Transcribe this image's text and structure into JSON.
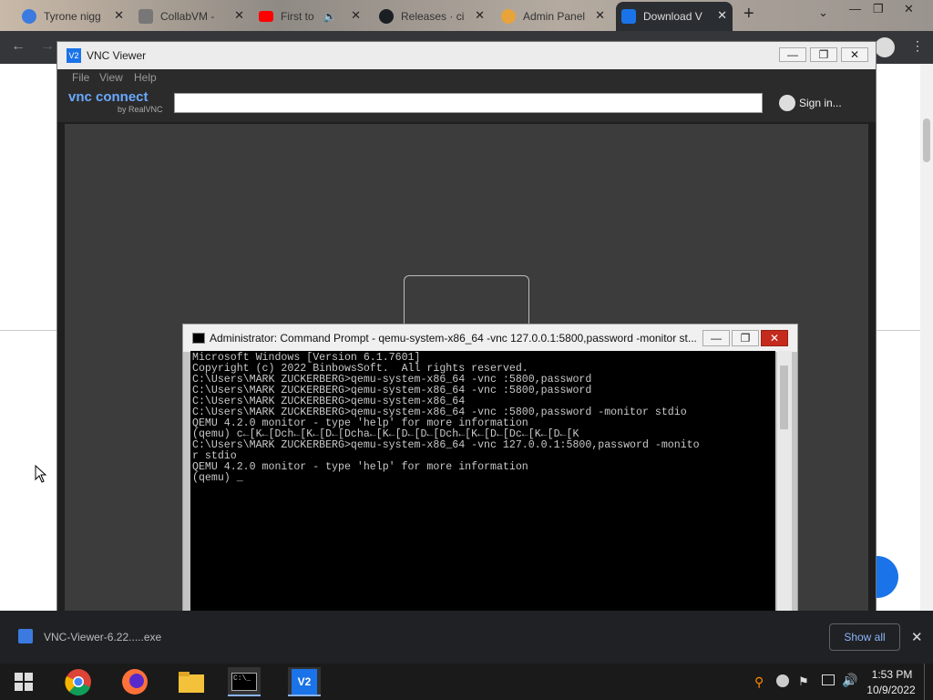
{
  "browser": {
    "tabs": [
      {
        "label": "Tyrone nigg",
        "fav_color": "#3b7be0"
      },
      {
        "label": "CollabVM -",
        "fav_color": "#777777"
      },
      {
        "label": "First to",
        "fav_color": "#ff0000"
      },
      {
        "label": "Releases · ci",
        "fav_color": "#1b1f23"
      },
      {
        "label": "Admin Panel",
        "fav_color": "#e8a33a"
      },
      {
        "label": "Download V",
        "fav_color": "#1a73e8"
      }
    ],
    "new_tab": "+",
    "window_controls": [
      "⌄",
      "—",
      "❐",
      "✕"
    ]
  },
  "vnc": {
    "title": "VNC Viewer",
    "logo_icon_text": "V2",
    "menu": [
      "File",
      "View",
      "Help"
    ],
    "brand_main": "vnc connect",
    "brand_sub": "by RealVNC",
    "search_value": "",
    "sign_in": "Sign in..."
  },
  "cmd": {
    "title": "Administrator: Command Prompt - qemu-system-x86_64  -vnc 127.0.0.1:5800,password -monitor st...",
    "lines": [
      "Microsoft Windows [Version 6.1.7601]",
      "Copyright (c) 2022 BinbowsSoft.  All rights reserved.",
      "",
      "C:\\Users\\MARK ZUCKERBERG>qemu-system-x86_64 -vnc :5800,password",
      "",
      "C:\\Users\\MARK ZUCKERBERG>qemu-system-x86_64 -vnc :5800,password",
      "",
      "C:\\Users\\MARK ZUCKERBERG>qemu-system-x86_64",
      "",
      "C:\\Users\\MARK ZUCKERBERG>qemu-system-x86_64 -vnc :5800,password -monitor stdio",
      "QEMU 4.2.0 monitor - type 'help' for more information",
      "(qemu) c←[K←[Dch←[K←[D←[Dcha←[K←[D←[D←[Dch←[K←[D←[Dc←[K←[D←[K",
      "C:\\Users\\MARK ZUCKERBERG>qemu-system-x86_64 -vnc 127.0.0.1:5800,password -monito",
      "r stdio",
      "QEMU 4.2.0 monitor - type 'help' for more information",
      "(qemu) _"
    ]
  },
  "download": {
    "file": "VNC-Viewer-6.22.....exe",
    "show_all": "Show all",
    "close": "✕"
  },
  "taskbar": {
    "time": "1:53 PM",
    "date": "10/9/2022",
    "cmd_icon_text": "C:\\_"
  },
  "colors": {
    "accent": "#1a73e8",
    "taskbar": "#1a1a1a",
    "chrome_dark": "#35363a",
    "close_red": "#c42b1c"
  }
}
